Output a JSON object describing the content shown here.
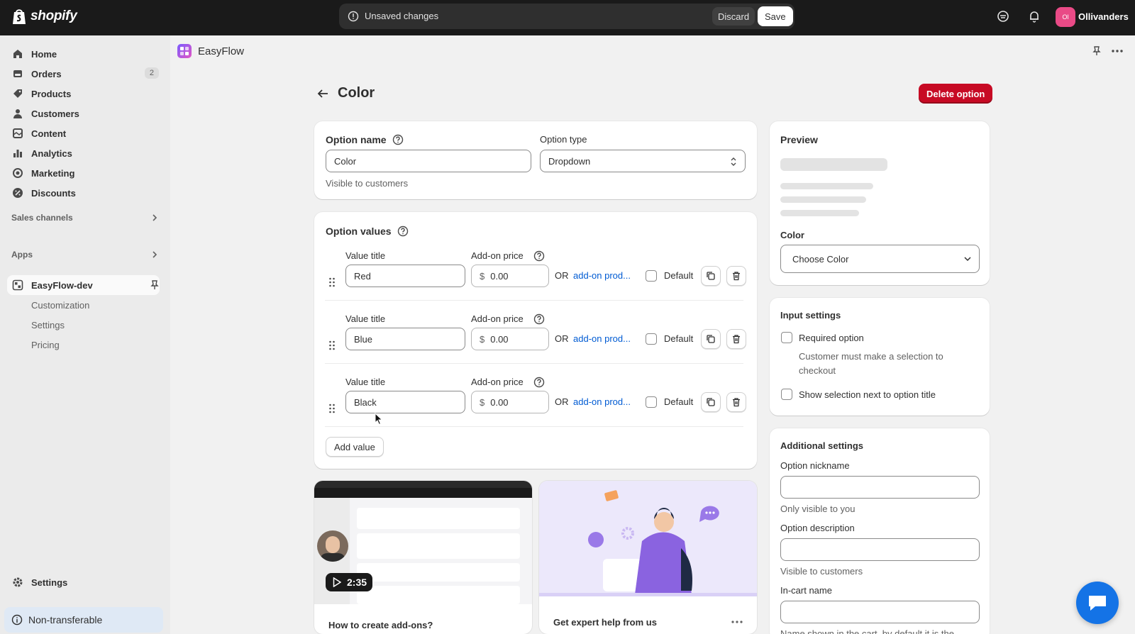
{
  "brand": {
    "name": "shopify"
  },
  "topbar": {
    "unsaved_text": "Unsaved changes",
    "discard_label": "Discard",
    "save_label": "Save",
    "avatar_initials": "Ol",
    "store_name": "Ollivanders"
  },
  "sidebar": {
    "items": [
      {
        "label": "Home",
        "icon": "home-icon"
      },
      {
        "label": "Orders",
        "icon": "orders-icon",
        "badge": "2"
      },
      {
        "label": "Products",
        "icon": "tag-icon"
      },
      {
        "label": "Customers",
        "icon": "person-icon"
      },
      {
        "label": "Content",
        "icon": "content-icon"
      },
      {
        "label": "Analytics",
        "icon": "bar-chart-icon"
      },
      {
        "label": "Marketing",
        "icon": "target-icon"
      },
      {
        "label": "Discounts",
        "icon": "discount-icon"
      }
    ],
    "sales_channels": "Sales channels",
    "apps": "Apps",
    "app_name": "EasyFlow-dev",
    "app_subitems": [
      "Customization",
      "Settings",
      "Pricing"
    ],
    "settings": "Settings",
    "non_transferable": "Non-transferable"
  },
  "app_header": {
    "title": "EasyFlow"
  },
  "page": {
    "title": "Color",
    "delete_label": "Delete option"
  },
  "option_card": {
    "name_label": "Option name",
    "name_value": "Color",
    "name_help": "Visible to customers",
    "type_label": "Option type",
    "type_value": "Dropdown"
  },
  "values_card": {
    "title": "Option values",
    "value_title_label": "Value title",
    "addon_price_label": "Add-on price",
    "currency": "$",
    "or_text": "OR",
    "addon_link": "add-on prod...",
    "default_label": "Default",
    "values": [
      {
        "title": "Red",
        "price": "0.00"
      },
      {
        "title": "Blue",
        "price": "0.00"
      },
      {
        "title": "Black",
        "price": "0.00"
      }
    ],
    "add_value_label": "Add value"
  },
  "preview_card": {
    "title": "Preview",
    "field_label": "Color",
    "select_placeholder": "Choose Color"
  },
  "input_settings": {
    "title": "Input settings",
    "required_label": "Required option",
    "required_help": "Customer must make a selection to checkout",
    "show_selection_label": "Show selection next to option title"
  },
  "additional_settings": {
    "title": "Additional settings",
    "nickname_label": "Option nickname",
    "nickname_help": "Only visible to you",
    "description_label": "Option description",
    "description_help": "Visible to customers",
    "incart_label": "In-cart name",
    "incart_help": "Name shown in the cart, by default it is the"
  },
  "video_card": {
    "duration": "2:35",
    "caption": "How to create add-ons?"
  },
  "help_card": {
    "caption": "Get expert help from us"
  }
}
